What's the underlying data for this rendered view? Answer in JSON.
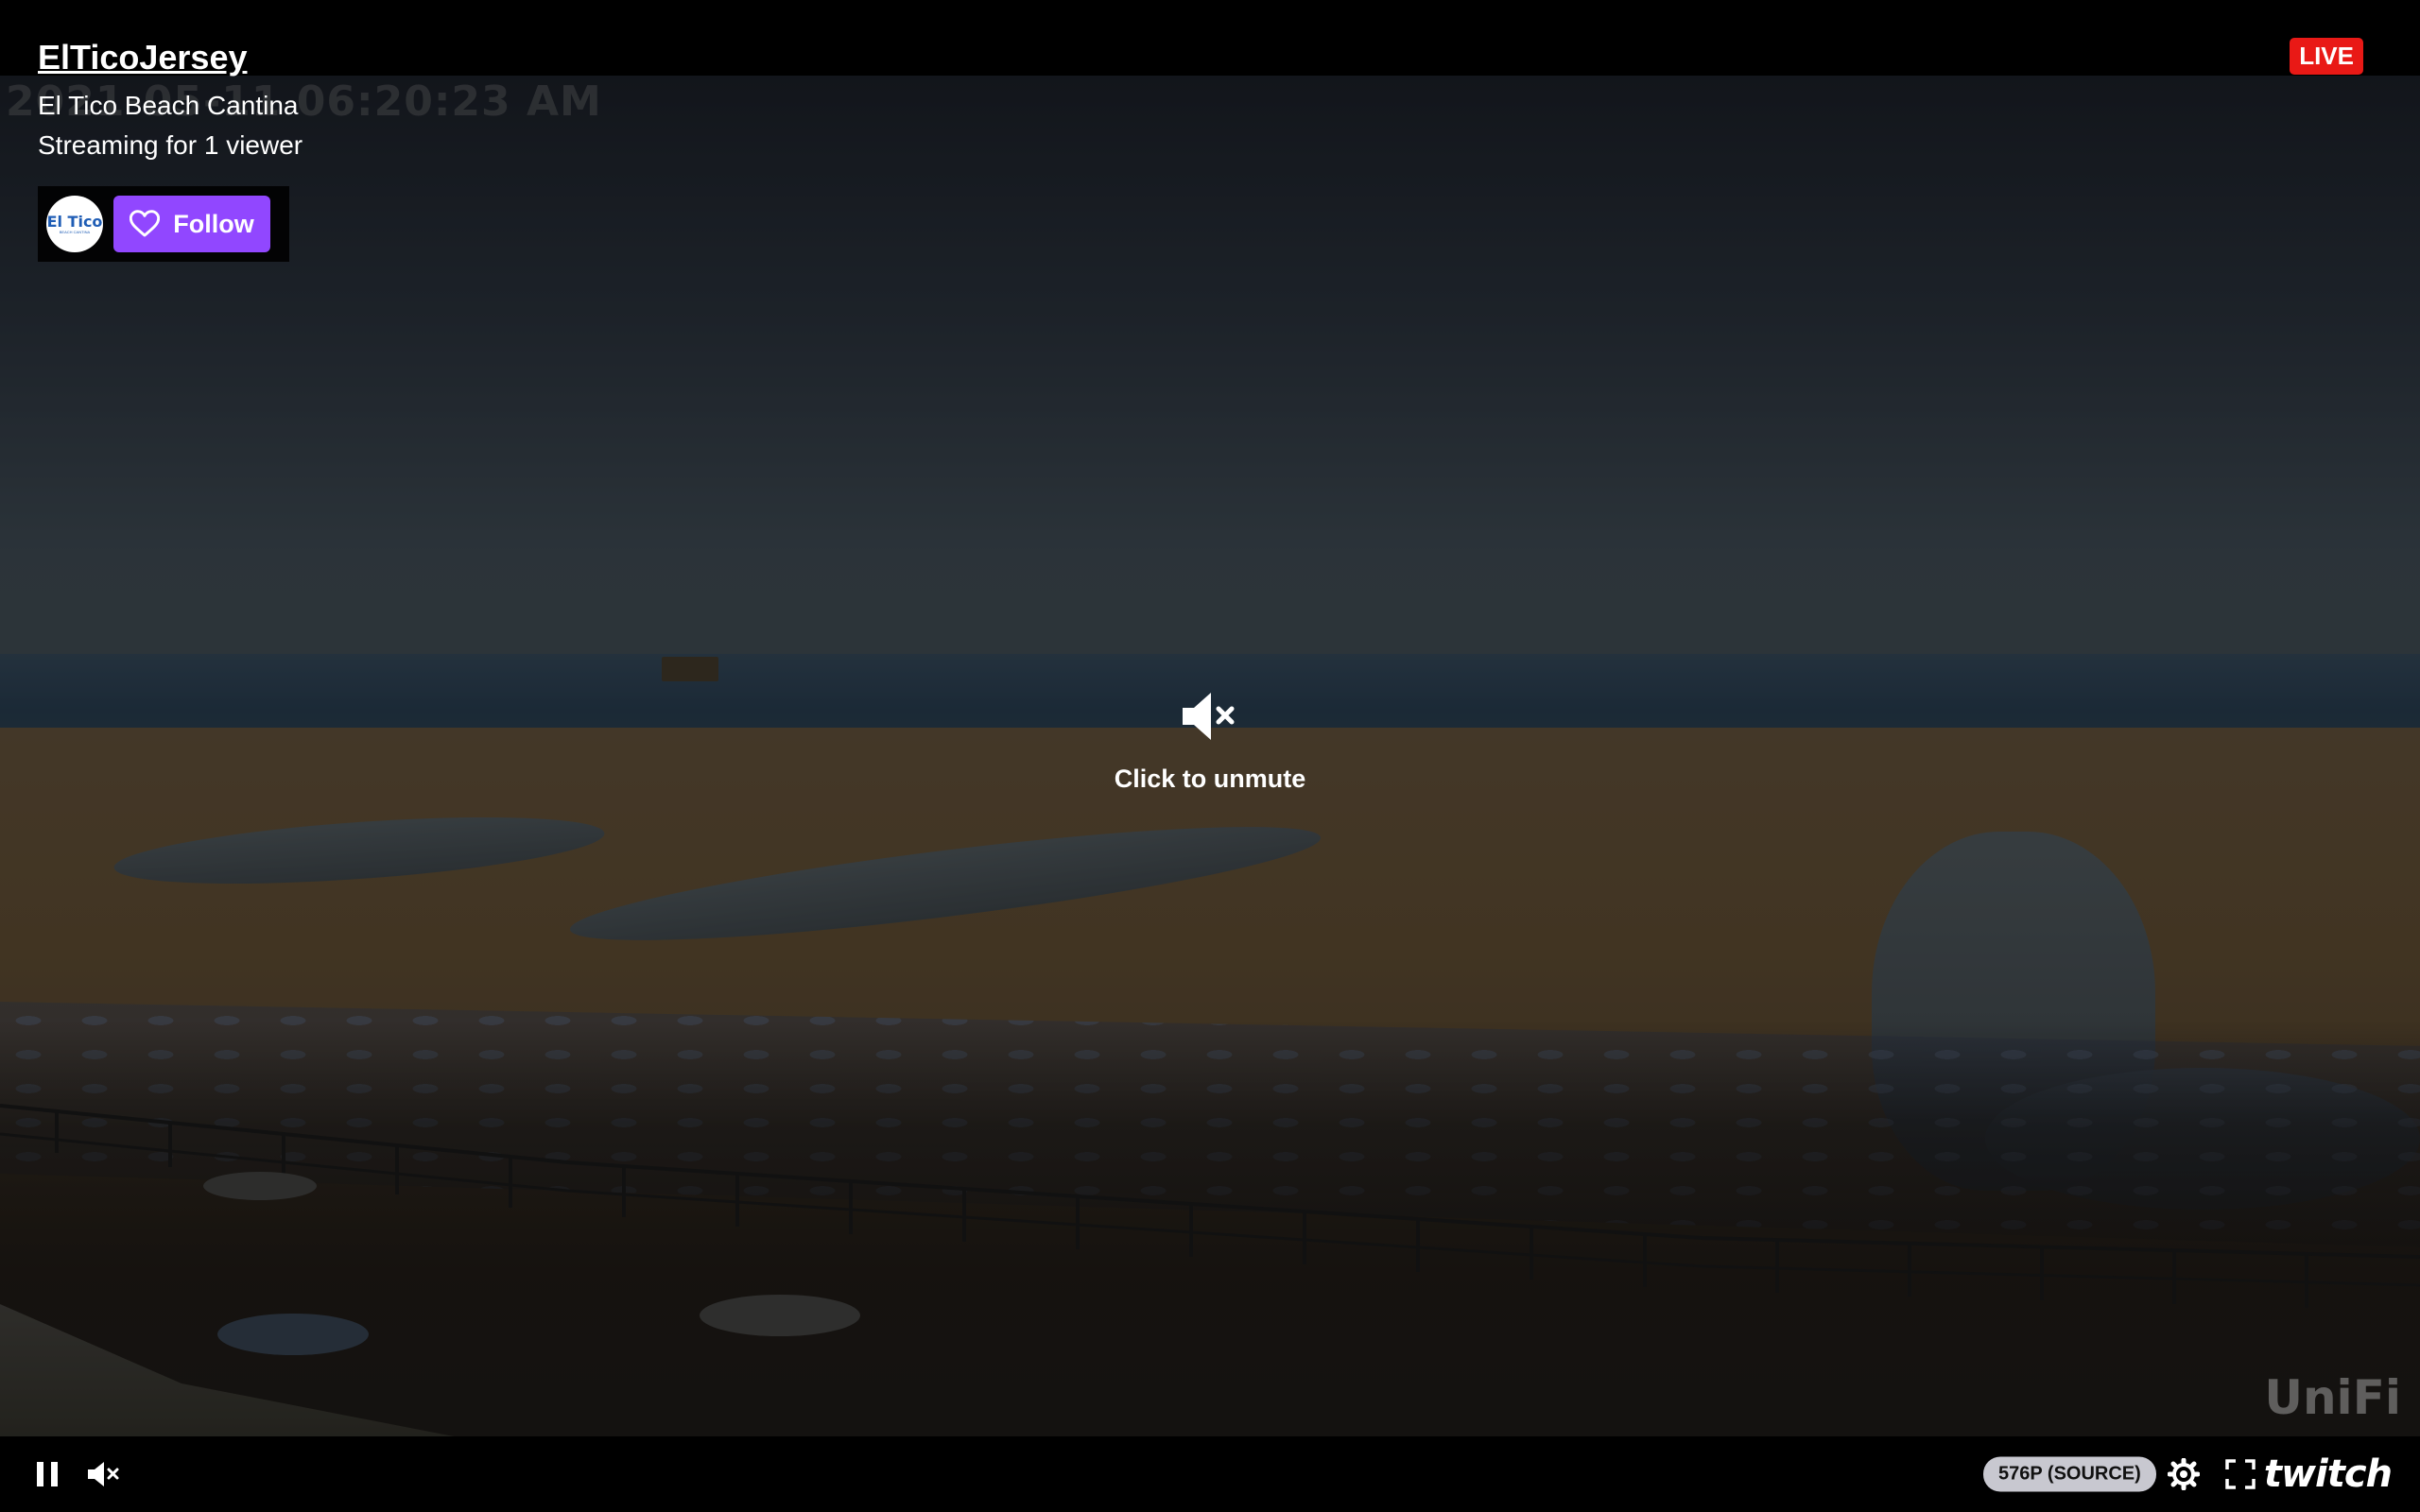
{
  "stream": {
    "channel_name": "ElTicoJersey",
    "title": "El Tico Beach Cantina",
    "viewers_text": "Streaming for 1 viewer",
    "live_label": "LIVE"
  },
  "avatar": {
    "logo_text": "El Tico",
    "logo_sub": "BEACH CANTINA"
  },
  "follow": {
    "label": "Follow",
    "icon": "heart-icon"
  },
  "overlay": {
    "unmute_label": "Click to unmute",
    "unmute_icon": "speaker-muted-icon"
  },
  "video": {
    "timestamp_text": "2021-05-11 06:20:23 AM",
    "watermark": "UniFi"
  },
  "controls": {
    "quality_label": "576P (SOURCE)",
    "brand": "twitch",
    "icons": [
      "pause-icon",
      "volume-muted-icon",
      "settings-icon",
      "fullscreen-icon"
    ]
  },
  "colors": {
    "accent": "#9147ff",
    "live": "#e91916",
    "quality_pill": "#c8c8d0"
  }
}
